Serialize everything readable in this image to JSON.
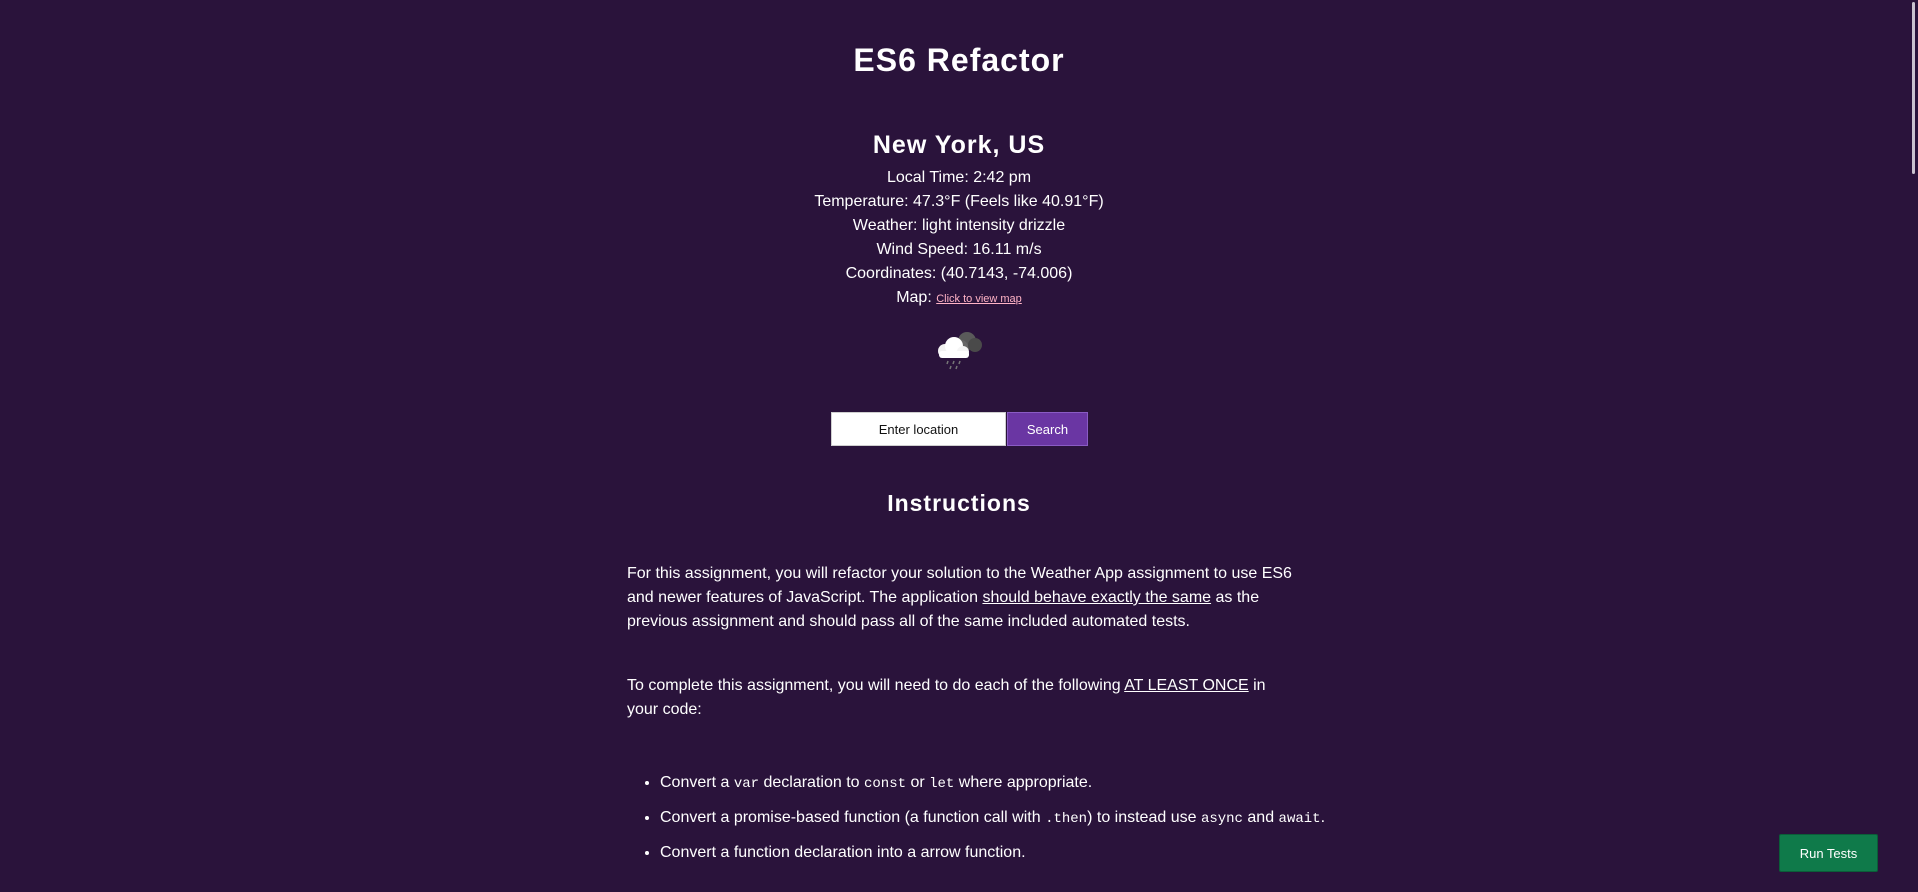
{
  "page": {
    "title": "ES6 Refactor"
  },
  "weather": {
    "city": "New York, US",
    "local_time": "Local Time: 2:42 pm",
    "temperature": "Temperature: 47.3°F (Feels like 40.91°F)",
    "condition": "Weather: light intensity drizzle",
    "wind_speed": "Wind Speed: 16.11 m/s",
    "coordinates": "Coordinates: (40.7143, -74.006)",
    "map_label": "Map: ",
    "map_link_text": "Click to view map",
    "icon": "drizzle-cloud-icon"
  },
  "search": {
    "placeholder": "Enter location",
    "button_label": "Search"
  },
  "instructions": {
    "title": "Instructions",
    "para1": {
      "before": "For this assignment, you will refactor your solution to the Weather App assignment to use ES6 and newer features of JavaScript. The application ",
      "emphasis": "should behave exactly the same",
      "after": " as the previous assignment and should pass all of the same included automated tests."
    },
    "para2": {
      "before": "To complete this assignment, you will need to do each of the following ",
      "emphasis": "AT LEAST ONCE",
      "after": " in your code:"
    },
    "items": [
      {
        "t1": "Convert a ",
        "c1": "var",
        "t2": " declaration to ",
        "c2": "const",
        "t3": " or ",
        "c3": "let",
        "t4": " where appropriate."
      },
      {
        "t1": "Convert a promise-based function (a function call with ",
        "c1": ".then",
        "t2": ") to instead use ",
        "c2": "async",
        "t3": " and ",
        "c3": "await",
        "t4": "."
      },
      {
        "t1": "Convert a function declaration into a arrow function."
      }
    ]
  },
  "actions": {
    "run_tests_label": "Run Tests"
  },
  "colors": {
    "background": "#2a133b",
    "search_button": "#6a36a3",
    "run_tests_button": "#0f7a4a",
    "map_link": "#ffb3c6"
  }
}
